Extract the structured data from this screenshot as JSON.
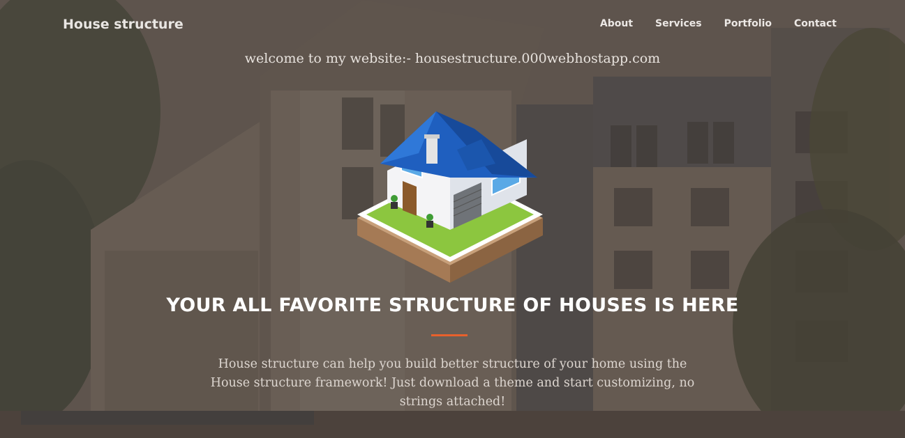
{
  "navbar": {
    "brand": "House structure",
    "links": [
      "About",
      "Services",
      "Portfolio",
      "Contact"
    ]
  },
  "hero": {
    "welcome": "welcome to my website:- housestructure.000webhostapp.com",
    "headline": "YOUR ALL FAVORITE STRUCTURE OF HOUSES IS HERE",
    "description": "House structure can help you build better structure of your home using the House structure framework! Just download a theme and start customizing, no strings attached!"
  },
  "theme": {
    "accent": "#e8612c",
    "roof": "#1f5fbf",
    "lawn": "#8cc63f"
  }
}
